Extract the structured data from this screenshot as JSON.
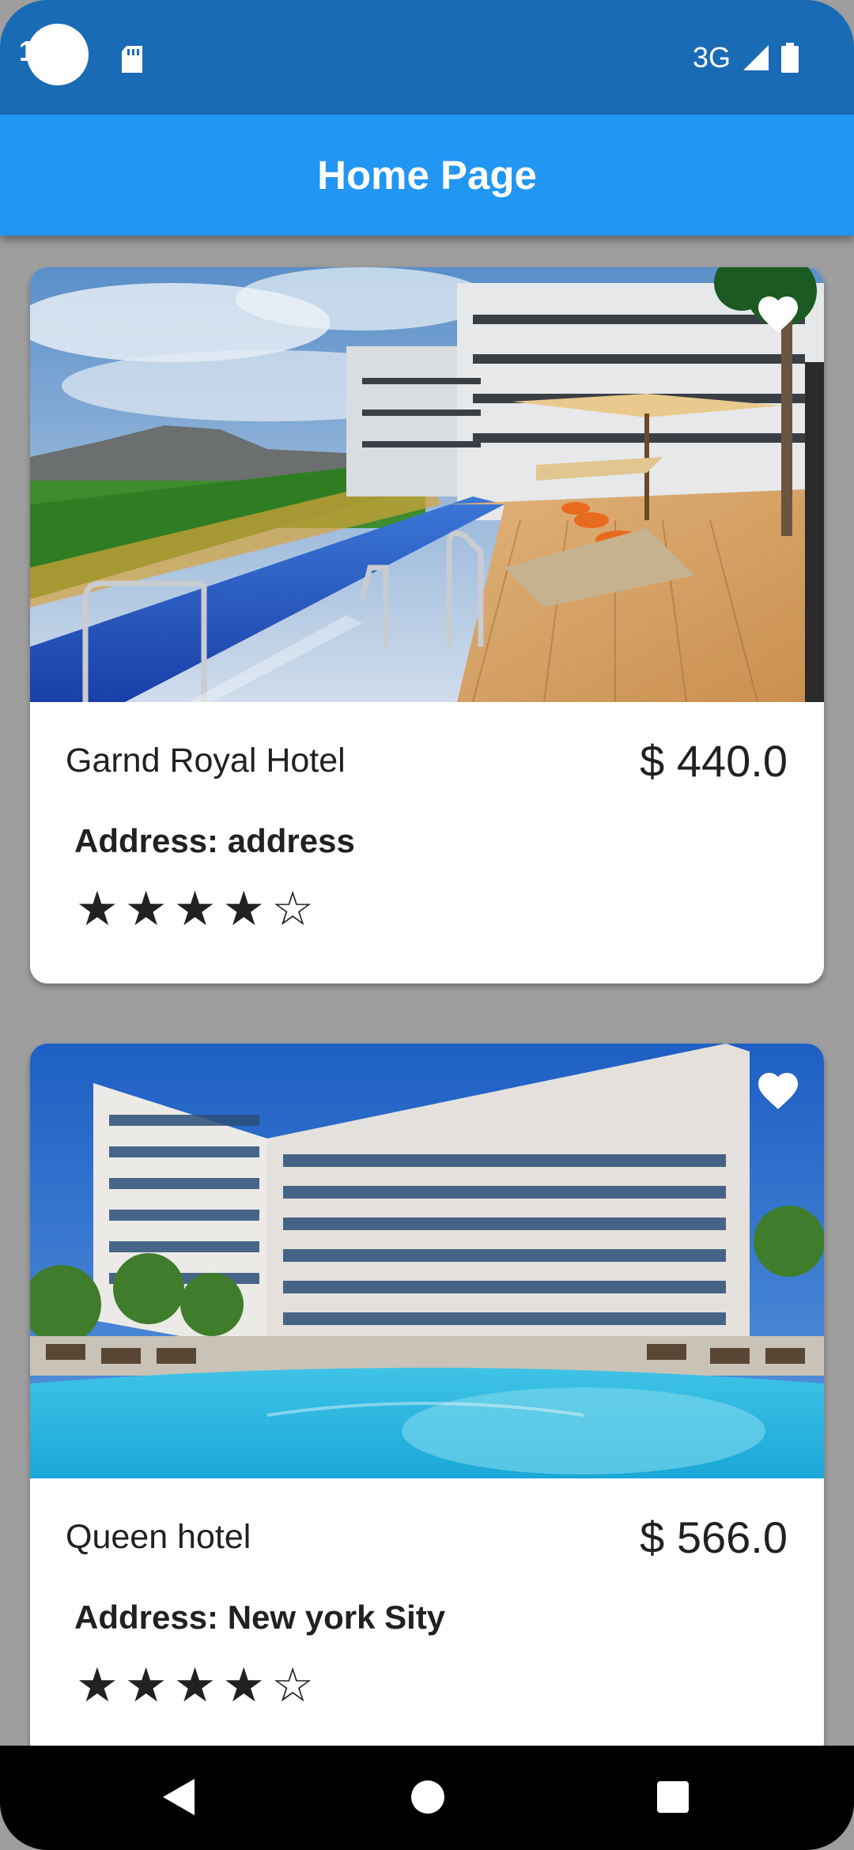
{
  "status_bar": {
    "time": "1",
    "network": "3G",
    "icons": [
      "camera-dot",
      "sd-card-icon",
      "signal-icon",
      "battery-icon"
    ]
  },
  "app_bar": {
    "title": "Home Page"
  },
  "hotels": [
    {
      "name": "Garnd Royal Hotel",
      "price": "$ 440.0",
      "address": "Address: address",
      "rating": 4,
      "max_rating": 5,
      "favorite_icon": "heart-icon"
    },
    {
      "name": "Queen hotel",
      "price": "$ 566.0",
      "address": "Address: New york Sity",
      "rating": 4,
      "max_rating": 5,
      "favorite_icon": "heart-icon"
    }
  ],
  "nav": {
    "icons": [
      "back-icon",
      "home-icon",
      "recents-icon"
    ]
  },
  "colors": {
    "status_bar": "#1a6bb5",
    "app_bar": "#2196f3",
    "background": "#9e9e9e"
  }
}
